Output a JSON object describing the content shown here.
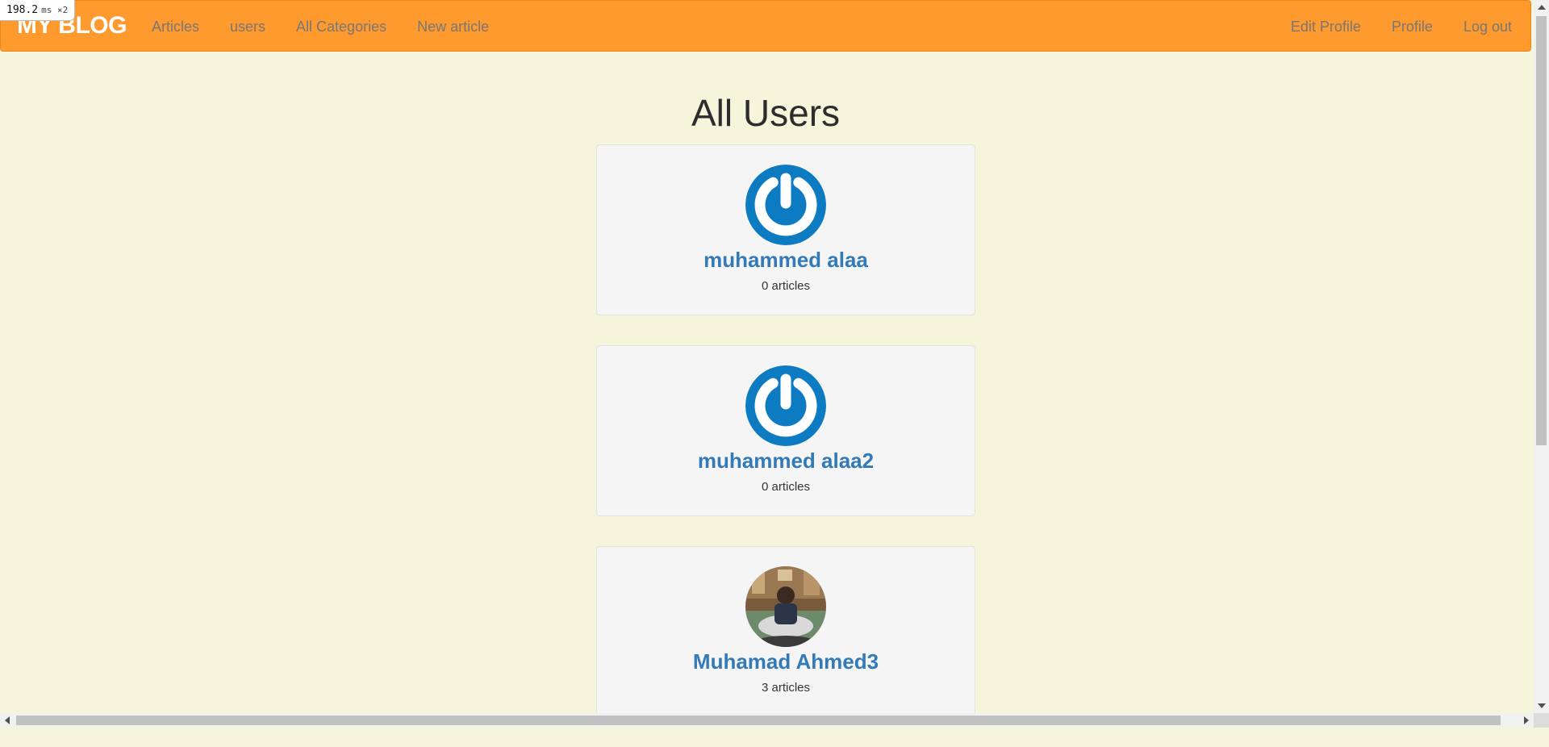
{
  "perf_badge": {
    "value": "198.2",
    "unit": "ms ×2"
  },
  "navbar": {
    "brand": "MY BLOG",
    "left_links": [
      {
        "label": "Articles"
      },
      {
        "label": "users"
      },
      {
        "label": "All Categories"
      },
      {
        "label": "New article"
      }
    ],
    "right_links": [
      {
        "label": "Edit Profile"
      },
      {
        "label": "Profile"
      },
      {
        "label": "Log out"
      }
    ]
  },
  "main": {
    "title": "All Users",
    "users": [
      {
        "name": "muhammed alaa",
        "articles": "0 articles",
        "avatar": "power-logo-icon"
      },
      {
        "name": "muhammed alaa2",
        "articles": "0 articles",
        "avatar": "power-logo-icon"
      },
      {
        "name": "Muhamad Ahmed3",
        "articles": "3 articles",
        "avatar": "profile-photo"
      }
    ]
  },
  "colors": {
    "navbar_bg": "#ff9a2e",
    "page_bg": "#f5f5dc",
    "link_blue": "#337ab7",
    "nav_link_gray": "#777777",
    "avatar_blue": "#0d7bc1"
  }
}
